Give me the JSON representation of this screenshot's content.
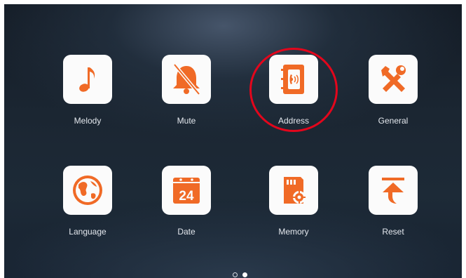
{
  "accent_color": "#f06a26",
  "highlight_color": "#e3061c",
  "apps": [
    {
      "label": "Melody",
      "icon": "music-note-icon"
    },
    {
      "label": "Mute",
      "icon": "bell-muted-icon"
    },
    {
      "label": "Address",
      "icon": "address-book-icon"
    },
    {
      "label": "General",
      "icon": "tools-icon"
    },
    {
      "label": "Language",
      "icon": "globe-icon"
    },
    {
      "label": "Date",
      "icon": "calendar-icon",
      "icon_text": "24"
    },
    {
      "label": "Memory",
      "icon": "sd-card-icon"
    },
    {
      "label": "Reset",
      "icon": "reset-arrow-icon"
    }
  ],
  "pagination": {
    "pages": 2,
    "current": 2
  }
}
